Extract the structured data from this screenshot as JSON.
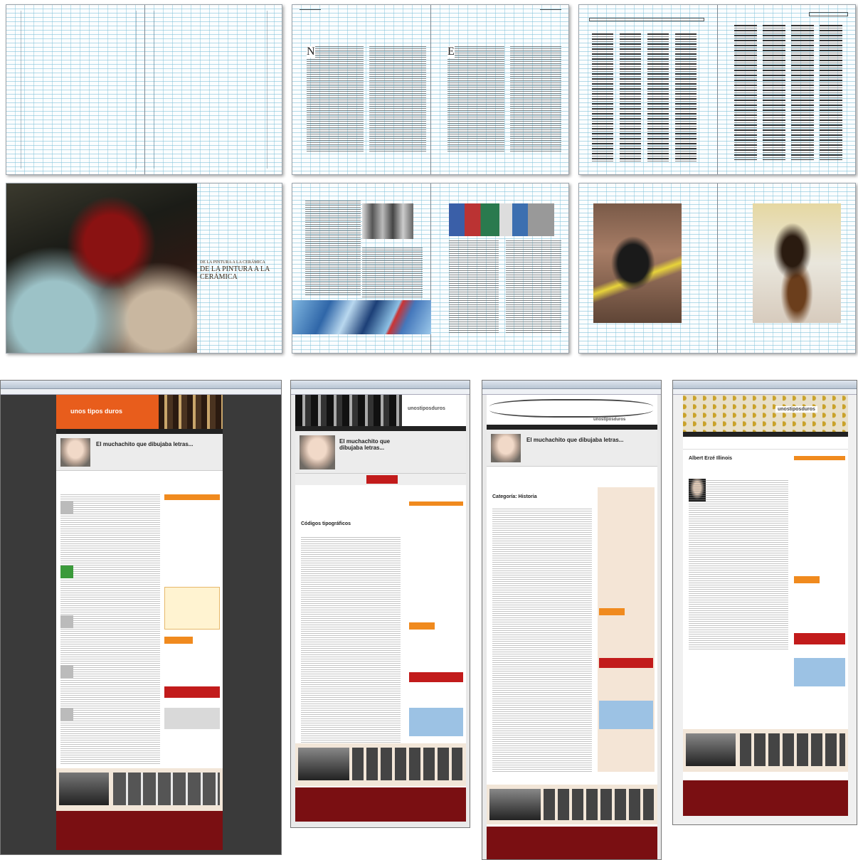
{
  "spreads": {
    "cover_title_small": "DE LA PINTURA A LA CERÁMICA",
    "cover_title_large": "DE LA PINTURA A LA CERÁMICA",
    "dropcap_left": "N",
    "dropcap_right": "E"
  },
  "websites": [
    {
      "logo": "unos tipos duros",
      "headline": "El muchachito que dibujaba letras...",
      "accent": "#e85d1c"
    },
    {
      "logo": "unostiposduros",
      "headline": "El muchachito que dibujaba letras...",
      "section_title": "Códigos tipográficos",
      "accent": "#e85d1c"
    },
    {
      "logo": "unostiposduros",
      "headline": "El muchachito que dibujaba letras...",
      "section_title": "Categoría: Historia",
      "accent": "#e85d1c"
    },
    {
      "logo": "unostiposduros",
      "headline": "Albert Erzé Illinois",
      "accent": "#e85d1c"
    }
  ],
  "colors": {
    "grid_blue": "#78bed7",
    "footer_red": "#7a0f12",
    "accent_orange": "#f08a1e",
    "dark_background": "#3a3a3a"
  }
}
